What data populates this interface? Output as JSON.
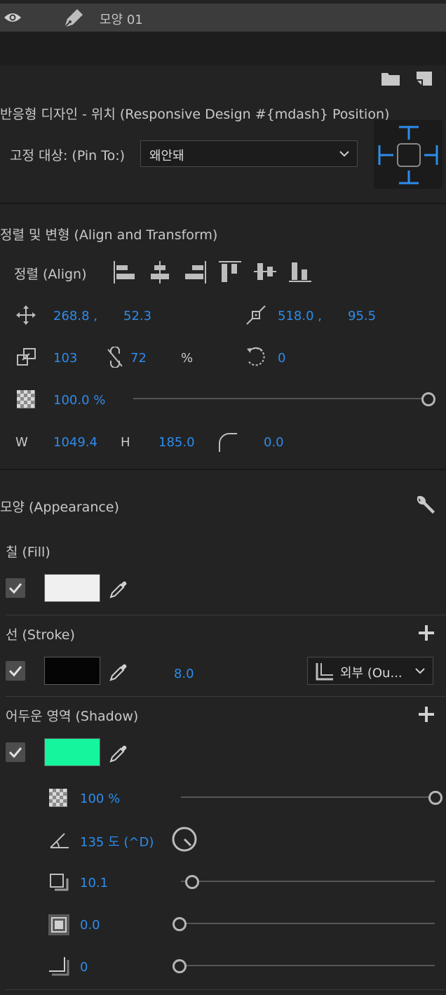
{
  "layer": {
    "name": "모양 01"
  },
  "responsive": {
    "title": "반응형 디자인 - 위치 (Responsive Design #{mdash} Position)",
    "pin_label": "고정 대상: (Pin To:)",
    "pin_value": "왜안돼"
  },
  "align_transform": {
    "title": "정렬 및 변형 (Align and Transform)",
    "align_label": "정렬 (Align)",
    "position_x": "268.8 ,",
    "position_y": "52.3",
    "anchor_x": "518.0 ,",
    "anchor_y": "95.5",
    "scale_a": "103",
    "scale_b": "72",
    "scale_unit": "%",
    "rotation": "0",
    "opacity": "100.0 %",
    "opacity_level": 1.0,
    "w_label": "W",
    "w_value": "1049.4",
    "h_label": "H",
    "h_value": "185.0",
    "corner_radius": "0.0"
  },
  "appearance": {
    "title": "모양 (Appearance)",
    "fill": {
      "title": "칠 (Fill)",
      "color": "#f0f0f0",
      "checked": true
    },
    "stroke": {
      "title": "선 (Stroke)",
      "color": "#050505",
      "width": "8.0",
      "position": "외부 (Ou...",
      "checked": true
    },
    "shadow": {
      "title": "어두운 영역 (Shadow)",
      "color": "#14f59e",
      "checked": true,
      "opacity": "100 %",
      "opacity_level": 1.0,
      "angle": "135 도 (^D)",
      "distance": "10.1",
      "distance_level": 0.04,
      "size": "0.0",
      "size_level": 0.0,
      "blur": "0",
      "blur_level": 0.0
    }
  },
  "colors": {
    "accent": "#2d8ceb",
    "panel": "#232323",
    "header": "#3a3a3a"
  }
}
